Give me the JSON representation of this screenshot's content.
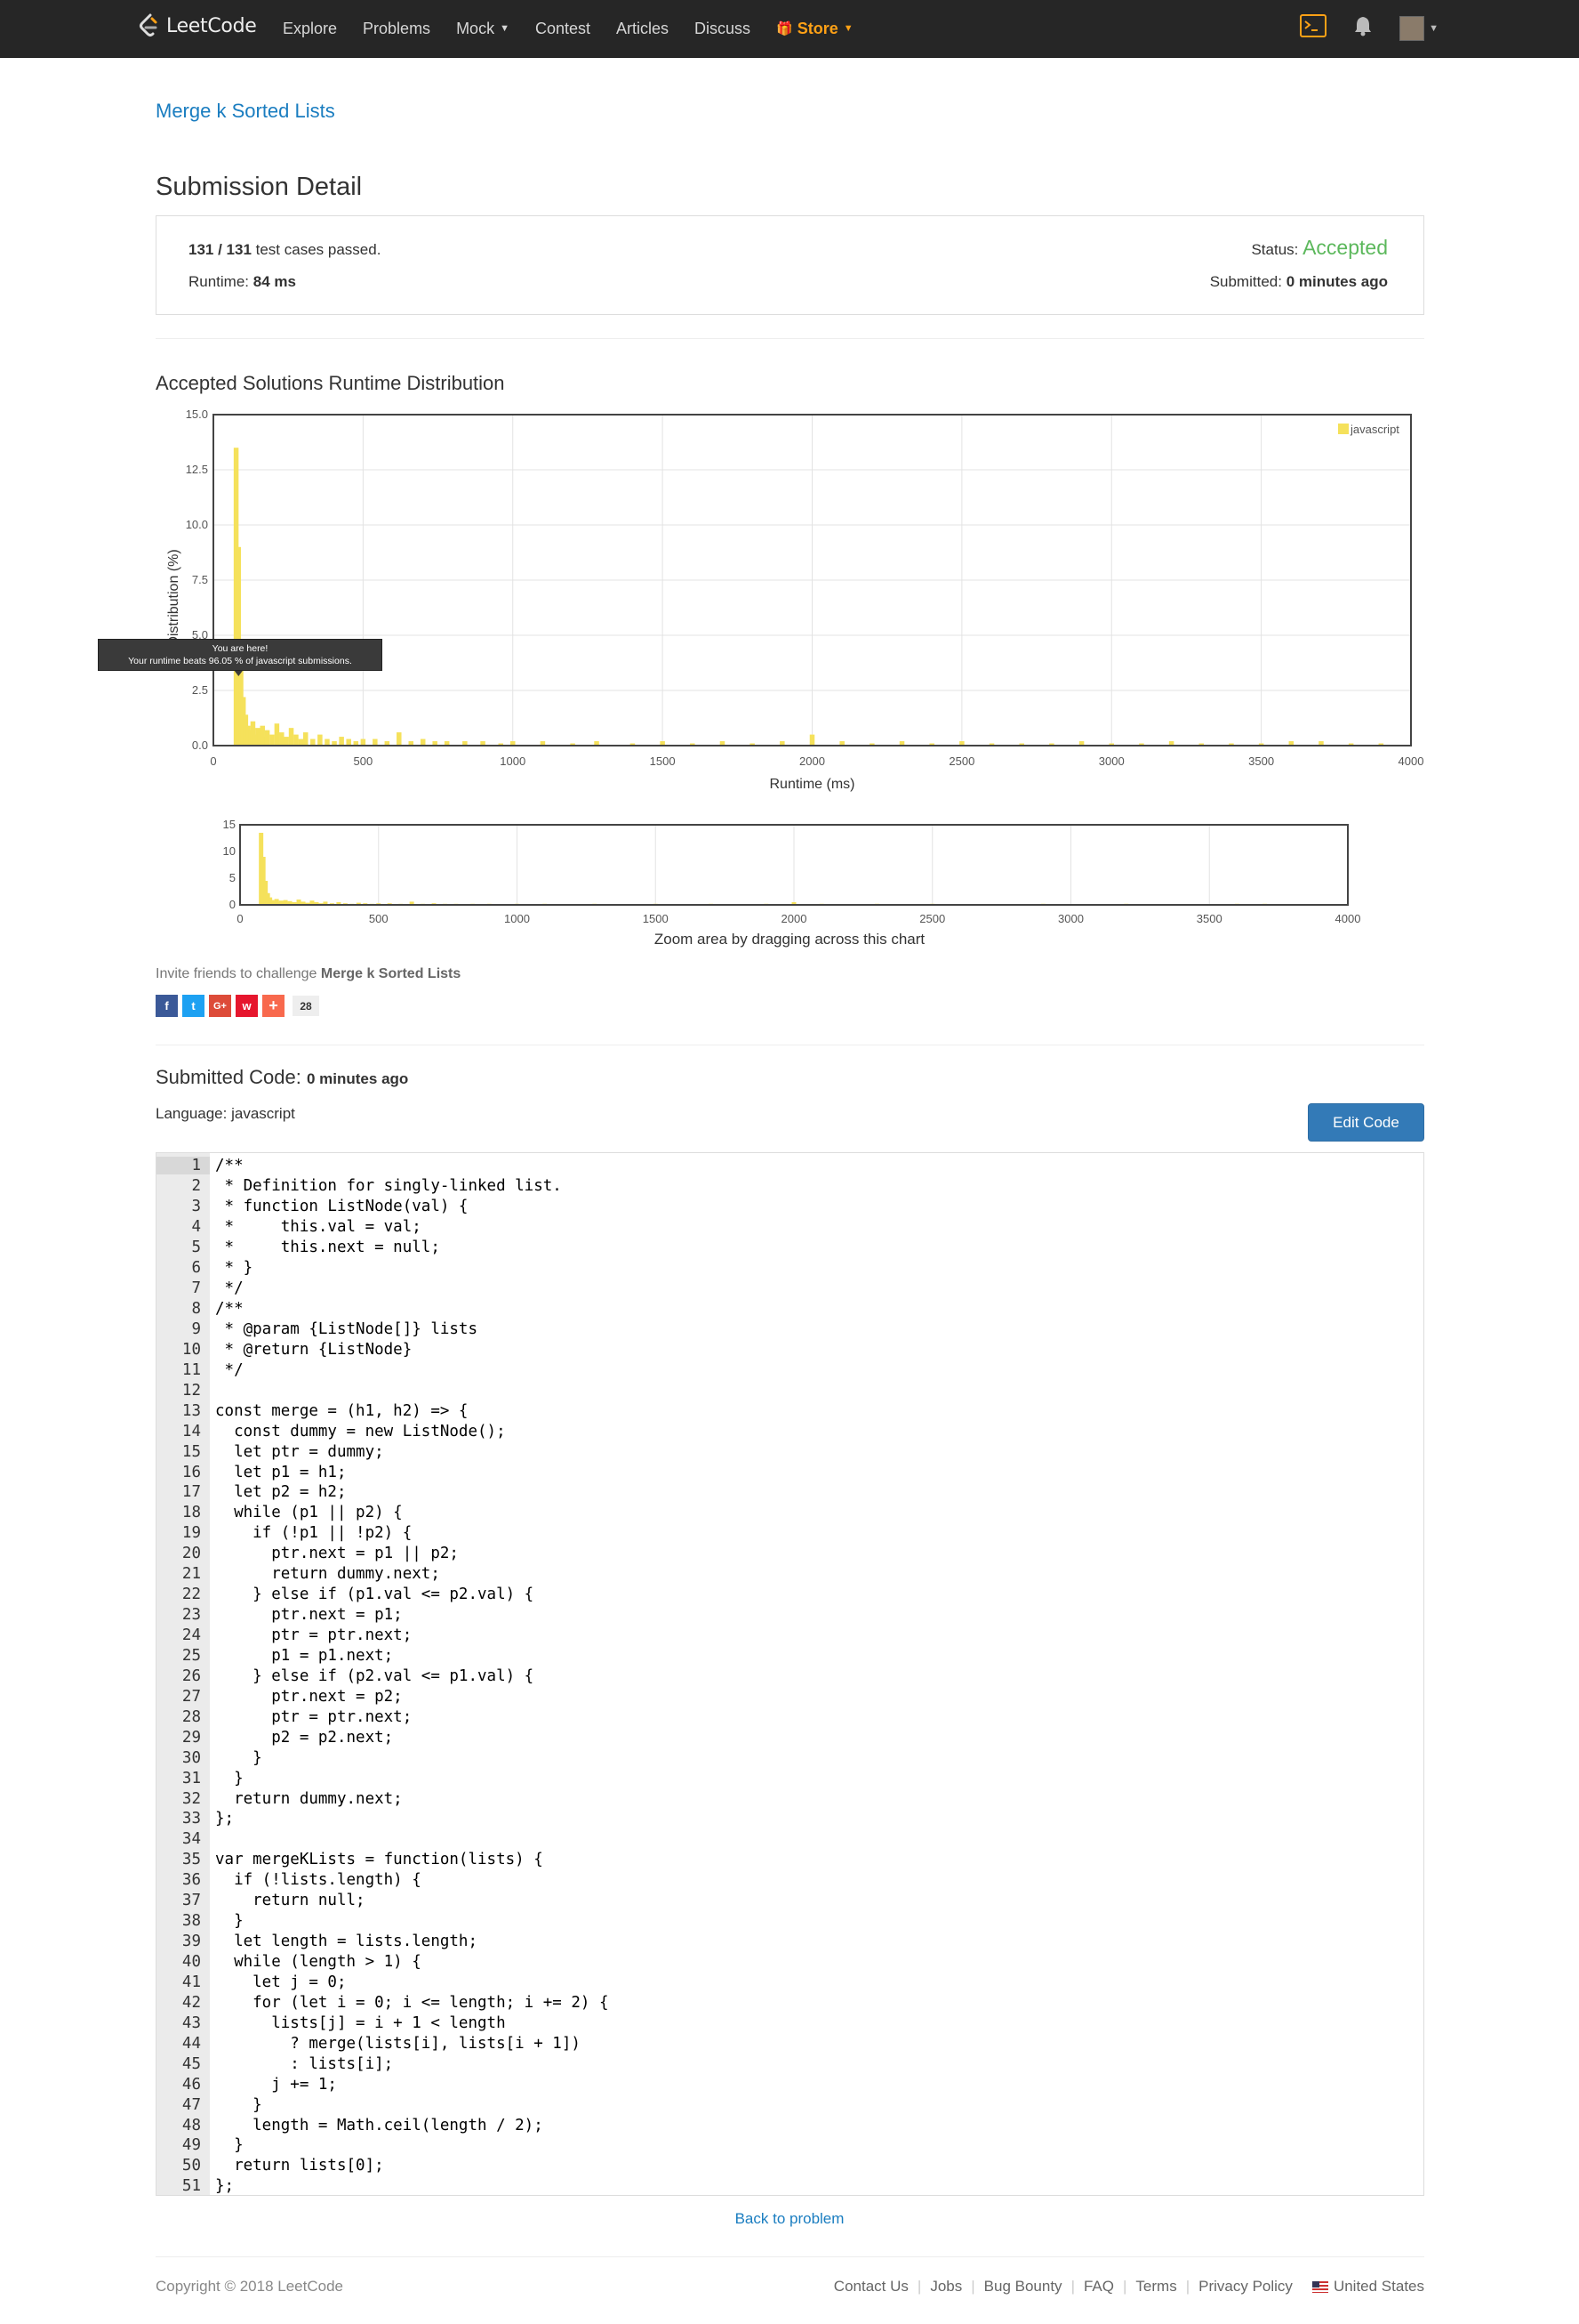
{
  "nav": {
    "brand": "LeetCode",
    "items": [
      "Explore",
      "Problems",
      "Mock",
      "Contest",
      "Articles",
      "Discuss"
    ],
    "store": "Store",
    "icons": [
      "terminal-icon",
      "bell-icon",
      "avatar"
    ]
  },
  "problem": {
    "title": "Merge k Sorted Lists"
  },
  "detail": {
    "heading": "Submission Detail",
    "cases_passed": "131 / 131",
    "cases_suffix": " test cases passed.",
    "runtime_label": "Runtime: ",
    "runtime_value": "84 ms",
    "status_label": "Status: ",
    "status_value": "Accepted",
    "submitted_label": "Submitted: ",
    "submitted_value": "0 minutes ago"
  },
  "distribution": {
    "title": "Accepted Solutions Runtime Distribution",
    "tooltip_title": "You are here!",
    "tooltip_text": "Your runtime beats 96.05 % of javascript submissions.",
    "zoom_hint": "Zoom area by dragging across this chart"
  },
  "chart_data": [
    {
      "type": "bar",
      "xlabel": "Runtime (ms)",
      "ylabel": "Distribution (%)",
      "xlim": [
        0,
        4000
      ],
      "ylim": [
        0,
        15
      ],
      "xticks": [
        0,
        500,
        1000,
        1500,
        2000,
        2500,
        3000,
        3500,
        4000
      ],
      "yticks": [
        "0.0",
        "2.5",
        "5.0",
        "7.5",
        "10.0",
        "12.5",
        "15.0"
      ],
      "legend": "top-right",
      "grid": true,
      "series": [
        {
          "name": "javascript",
          "color": "#f5e15b",
          "x": [
            76,
            84,
            92,
            100,
            108,
            116,
            124,
            132,
            140,
            148,
            156,
            164,
            172,
            180,
            196,
            212,
            228,
            244,
            260,
            276,
            292,
            308,
            332,
            356,
            380,
            404,
            428,
            452,
            476,
            500,
            540,
            580,
            620,
            660,
            700,
            740,
            780,
            840,
            900,
            960,
            1000,
            1100,
            1200,
            1280,
            1400,
            1500,
            1600,
            1700,
            1800,
            1900,
            2000,
            2100,
            2200,
            2300,
            2400,
            2500,
            2600,
            2700,
            2800,
            2900,
            3000,
            3100,
            3200,
            3300,
            3400,
            3500,
            3600,
            3700,
            3800,
            3900
          ],
          "y": [
            13.5,
            9.0,
            4.5,
            2.2,
            1.4,
            0.9,
            0.7,
            1.1,
            0.5,
            0.8,
            0.6,
            0.9,
            0.4,
            0.7,
            0.5,
            1.0,
            0.6,
            0.4,
            0.8,
            0.5,
            0.3,
            0.6,
            0.3,
            0.5,
            0.3,
            0.2,
            0.4,
            0.3,
            0.2,
            0.3,
            0.3,
            0.2,
            0.6,
            0.2,
            0.3,
            0.2,
            0.2,
            0.2,
            0.2,
            0.1,
            0.2,
            0.2,
            0.1,
            0.2,
            0.1,
            0.2,
            0.1,
            0.2,
            0.1,
            0.2,
            0.5,
            0.2,
            0.1,
            0.2,
            0.1,
            0.2,
            0.1,
            0.1,
            0.1,
            0.2,
            0.1,
            0.1,
            0.2,
            0.1,
            0.1,
            0.1,
            0.2,
            0.2,
            0.1,
            0.1
          ]
        }
      ],
      "highlight": {
        "x": 84,
        "label": "You are here!"
      }
    },
    {
      "type": "bar",
      "xlabel": "",
      "ylabel": "",
      "xlim": [
        0,
        4000
      ],
      "ylim": [
        0,
        15
      ],
      "xticks": [
        0,
        500,
        1000,
        1500,
        2000,
        2500,
        3000,
        3500,
        4000
      ],
      "yticks": [
        "0",
        "5",
        "10",
        "15"
      ],
      "grid": true
    }
  ],
  "invite": {
    "prefix": "Invite friends to challenge ",
    "problem": "Merge k Sorted Lists"
  },
  "social": {
    "count": "28"
  },
  "code": {
    "heading": "Submitted Code: ",
    "heading_time": "0 minutes ago",
    "language_label": "Language: javascript",
    "edit_button": "Edit Code",
    "lines": [
      "/**",
      " * Definition for singly-linked list.",
      " * function ListNode(val) {",
      " *     this.val = val;",
      " *     this.next = null;",
      " * }",
      " */",
      "/**",
      " * @param {ListNode[]} lists",
      " * @return {ListNode}",
      " */",
      "",
      "const merge = (h1, h2) => {",
      "  const dummy = new ListNode();",
      "  let ptr = dummy;",
      "  let p1 = h1;",
      "  let p2 = h2;",
      "  while (p1 || p2) {",
      "    if (!p1 || !p2) {",
      "      ptr.next = p1 || p2;",
      "      return dummy.next;",
      "    } else if (p1.val <= p2.val) {",
      "      ptr.next = p1;",
      "      ptr = ptr.next;",
      "      p1 = p1.next;",
      "    } else if (p2.val <= p1.val) {",
      "      ptr.next = p2;",
      "      ptr = ptr.next;",
      "      p2 = p2.next;",
      "    }",
      "  }",
      "  return dummy.next;",
      "};",
      "",
      "var mergeKLists = function(lists) {",
      "  if (!lists.length) {",
      "    return null;",
      "  }",
      "  let length = lists.length;",
      "  while (length > 1) {",
      "    let j = 0;",
      "    for (let i = 0; i <= length; i += 2) {",
      "      lists[j] = i + 1 < length",
      "        ? merge(lists[i], lists[i + 1])",
      "        : lists[i];",
      "      j += 1;",
      "    }",
      "    length = Math.ceil(length / 2);",
      "  }",
      "  return lists[0];",
      "};"
    ]
  },
  "back_link": "Back to problem",
  "footer": {
    "copyright": "Copyright © 2018 LeetCode",
    "links": [
      "Contact Us",
      "Jobs",
      "Bug Bounty",
      "FAQ",
      "Terms",
      "Privacy Policy"
    ],
    "region": "United States"
  }
}
